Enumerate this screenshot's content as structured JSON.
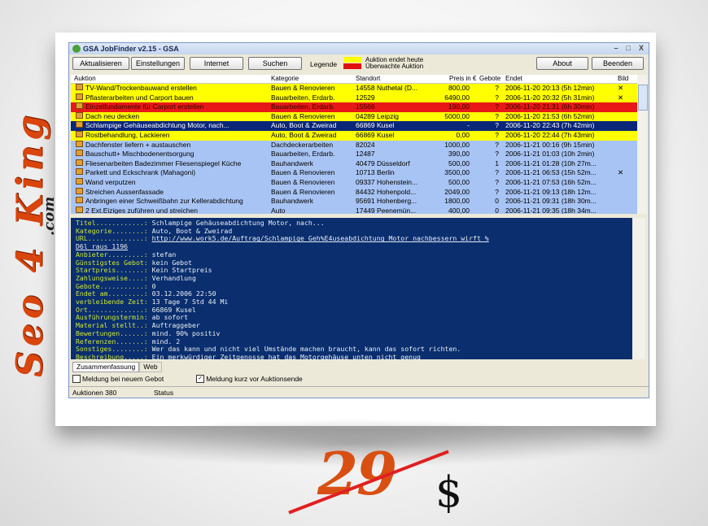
{
  "brand": {
    "side_text": "Seo 4 King",
    "side_suffix": ".com"
  },
  "window": {
    "title": "GSA JobFinder v2.15 - GSA",
    "min_label": "–",
    "max_label": "□",
    "close_label": "X"
  },
  "toolbar": {
    "aktualisieren": "Aktualisieren",
    "einstellungen": "Einstellungen",
    "internet": "Internet",
    "suchen": "Suchen",
    "legende": "Legende",
    "legend_today": "Auktion endet heute",
    "legend_watched": "Überwachte Auktion",
    "legend_today_color": "#ffff00",
    "legend_watched_color": "#e01010",
    "about": "About",
    "beenden": "Beenden"
  },
  "list": {
    "columns": {
      "auktion": "Auktion",
      "kategorie": "Kategorie",
      "standort": "Standort",
      "preis": "Preis in €",
      "gebote": "Gebote",
      "endet": "Endet",
      "bild": "Bild"
    },
    "rows": [
      {
        "title": "TV-Wand/Trockenbauwand erstellen",
        "cat": "Bauen & Renovieren",
        "loc": "14558 Nuthetal (D...",
        "price": "800,00",
        "bids": "?",
        "end": "2006-11-20 20:13 (5h 12min)",
        "img": "✕",
        "bg": "#ffff00",
        "fg": "#000000"
      },
      {
        "title": "Pflasterarbeiten und Carport bauen",
        "cat": "Bauarbeiten, Erdarb.",
        "loc": "12529",
        "price": "6490,00",
        "bids": "?",
        "end": "2006-11-20 20:32 (5h 31min)",
        "img": "✕",
        "bg": "#ffff00",
        "fg": "#000000"
      },
      {
        "title": "Einzelfundamente für Carport erstellen",
        "cat": "Bauarbeiten, Erdarb.",
        "loc": "15566",
        "price": "190,00",
        "bids": "?",
        "end": "2006-11-20 21:31 (6h 30min)",
        "img": "",
        "bg": "#e81818",
        "fg": "#3a0000"
      },
      {
        "title": "Dach neu decken",
        "cat": "Bauen & Renovieren",
        "loc": "04289 Leipzig",
        "price": "5000,00",
        "bids": "?",
        "end": "2006-11-20 21:53 (6h 52min)",
        "img": "",
        "bg": "#ffff00",
        "fg": "#000000"
      },
      {
        "title": "Schlampige Gehäuseabdichtung Motor, nach...",
        "cat": "Auto, Boot & Zweirad",
        "loc": "66869 Kusel",
        "price": "-",
        "bids": "?",
        "end": "2006-11-20 22:43 (7h 42min)",
        "img": "",
        "bg": "#0a2678",
        "fg": "#ffffff"
      },
      {
        "title": "Rostbehandlung, Lackieren",
        "cat": "Auto, Boot & Zweirad",
        "loc": "66869 Kusel",
        "price": "0,00",
        "bids": "?",
        "end": "2006-11-20 22:44 (7h 43min)",
        "img": "",
        "bg": "#ffff00",
        "fg": "#000000"
      },
      {
        "title": "Dachfenster liefern + austauschen",
        "cat": "Dachdeckerarbeiten",
        "loc": "82024",
        "price": "1000,00",
        "bids": "?",
        "end": "2006-11-21 00:16 (9h 15min)",
        "img": "",
        "bg": "#a8c4f4",
        "fg": "#000000"
      },
      {
        "title": "Bauschutt+ Mischbodenentsorgung",
        "cat": "Bauarbeiten, Erdarb.",
        "loc": "12487",
        "price": "390,00",
        "bids": "?",
        "end": "2006-11-21 01:03 (10h 2min)",
        "img": "",
        "bg": "#a8c4f4",
        "fg": "#000000"
      },
      {
        "title": "Fliesenarbeiten Badezimmer Fliesenspiegel Küche",
        "cat": "Bauhandwerk",
        "loc": "40479 Düsseldorf",
        "price": "500,00",
        "bids": "1",
        "end": "2006-11-21 01:28 (10h 27m...",
        "img": "",
        "bg": "#a8c4f4",
        "fg": "#000000"
      },
      {
        "title": "Parkett und Eckschrank (Mahagoni)",
        "cat": "Bauen & Renovieren",
        "loc": "10713 Berlin",
        "price": "3500,00",
        "bids": "?",
        "end": "2006-11-21 06:53 (15h 52m...",
        "img": "✕",
        "bg": "#a8c4f4",
        "fg": "#000000"
      },
      {
        "title": "Wand verputzen",
        "cat": "Bauen & Renovieren",
        "loc": "09337 Hohenstein...",
        "price": "500,00",
        "bids": "?",
        "end": "2006-11-21 07:53 (16h 52m...",
        "img": "",
        "bg": "#a8c4f4",
        "fg": "#000000"
      },
      {
        "title": "Streichen Aussenfassade",
        "cat": "Bauen & Renovieren",
        "loc": "84432 Hohenpold...",
        "price": "2049,00",
        "bids": "?",
        "end": "2006-11-21 09:13 (18h 12m...",
        "img": "",
        "bg": "#a8c4f4",
        "fg": "#000000"
      },
      {
        "title": "Anbringen einer Schweißbahn zur Kellerabdichtung",
        "cat": "Bauhandwerk",
        "loc": "95691 Hohenberg...",
        "price": "1800,00",
        "bids": "0",
        "end": "2006-11-21 09:31 (18h 30m...",
        "img": "",
        "bg": "#a8c4f4",
        "fg": "#000000"
      },
      {
        "title": "2 Ext.Eiziges zuführen und streichen",
        "cat": "Auto",
        "loc": "17449 Peenemün...",
        "price": "400,00",
        "bids": "0",
        "end": "2006-11-21 09:35 (18h 34m...",
        "img": "",
        "bg": "#a8c4f4",
        "fg": "#000000"
      }
    ]
  },
  "detail": {
    "lines": [
      {
        "label": "Titel............: ",
        "value": "Schlampige Gehäuseabdichtung Motor, nach..."
      },
      {
        "label": "Kategorie........: ",
        "value": "Auto, Boot & Zweirad"
      },
      {
        "label": "URL..............: ",
        "value": "http://www.work5.de/Auftrag/Schlampige_Geh%E4useabdichtung_Motor_nachbessern_wirft_%",
        "link": true
      },
      {
        "label": "",
        "value": "D6l_raus_1196",
        "link": true
      },
      {
        "label": "Anbieter.........: ",
        "value": "stefan"
      },
      {
        "label": "Günstigstes Gebot: ",
        "value": "kein Gebot"
      },
      {
        "label": "Startpreis.......: ",
        "value": "Kein Startpreis"
      },
      {
        "label": "Zahlungsweise....: ",
        "value": "Verhandlung"
      },
      {
        "label": "Gebote...........: ",
        "value": "0"
      },
      {
        "label": "Endet am.........: ",
        "value": "03.12.2006 22:50"
      },
      {
        "label": "verbleibende Zeit: ",
        "value": "13 Tage 7 Std 44 Mi"
      },
      {
        "label": "Ort..............: ",
        "value": "66869 Kusel"
      },
      {
        "label": "Ausführungstermin: ",
        "value": "ab sofort"
      },
      {
        "label": "Material stellt..: ",
        "value": "Auftraggeber"
      },
      {
        "label": "Bewertungen......: ",
        "value": "mind. 90% positiv"
      },
      {
        "label": "Referenzen.......: ",
        "value": "mind. 2"
      },
      {
        "label": "Sonstiges........: ",
        "value": "Wer das kann und nicht viel Umstände machen braucht, kann das sofort richten."
      },
      {
        "label": "Beschreibung.....: ",
        "value": "Ein merkwürdiger Zeitgenosse hat das Motorgehäuse unten nicht genug"
      }
    ]
  },
  "tabs": {
    "zusammenfassung": "Zusammenfassung",
    "web": "Web"
  },
  "options": {
    "meldung_neu": "Meldung bei neuem Gebot",
    "meldung_neu_checked": false,
    "meldung_ende": "Meldung kurz vor Auktionsende",
    "meldung_ende_checked": true
  },
  "status": {
    "auktionen": "Auktionen 380",
    "status": "Status"
  },
  "price": {
    "old_price": "29",
    "currency": "$"
  }
}
